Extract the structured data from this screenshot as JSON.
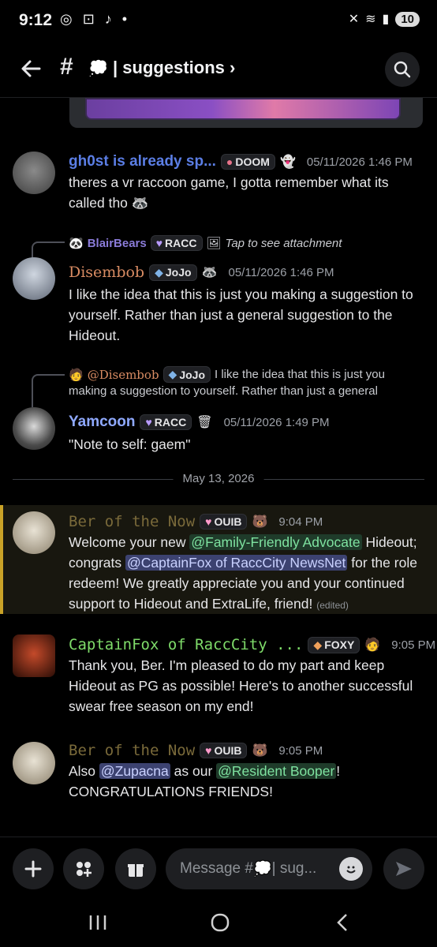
{
  "status": {
    "time": "9:12",
    "battery": "10"
  },
  "header": {
    "channel": "suggestions"
  },
  "messages": [
    {
      "author": "gh0st is already sp...",
      "tag": "DOOM",
      "time": "05/11/2026 1:46 PM",
      "text_a": "theres a vr raccoon game, I gotta remember what its",
      "text_b": "called tho"
    },
    {
      "reply_user": "BlairBears",
      "reply_tag": "RACC",
      "reply_text": "Tap to see attachment",
      "author": "Disembob",
      "tag": "JoJo",
      "time": "05/11/2026 1:46 PM",
      "text_a": "I like the idea that this is just you making a suggestion to",
      "text_b": "yourself. Rather than just a general suggestion to the",
      "text_c": "Hideout."
    },
    {
      "reply_user": "@Disembob",
      "reply_tag": "JoJo",
      "reply_text_a": "I like the idea that this is just you",
      "reply_text_b": "making a suggestion to yourself. Rather than just a general",
      "author": "Yamcoon",
      "tag": "RACC",
      "time": "05/11/2026 1:49 PM",
      "text_a": "\"Note to self: gaem\""
    },
    {
      "author": "Ber of the Now",
      "tag": "OUIB",
      "time": "9:04 PM",
      "p1": "Welcome your new ",
      "m1": "@Family-Friendly Advocate",
      "p2": " Hideout;",
      "p3": "congrats ",
      "m2": "@CaptainFox of RaccCity NewsNet",
      "p4": " for the role",
      "p5": "redeem! We greatly appreciate you and your continued",
      "p6": "support to Hideout and ExtraLife, friend!",
      "edited": "(edited)"
    },
    {
      "author": "CaptainFox of RaccCity ...",
      "tag": "FOXY",
      "time": "9:05 PM",
      "text_a": "Thank you, Ber. I'm pleased to do my part and keep",
      "text_b": "Hideout as PG as possible! Here's to another successful",
      "text_c": "swear free season on my end!"
    },
    {
      "author": "Ber of the Now",
      "tag": "OUIB",
      "time": "9:05 PM",
      "p1": "Also ",
      "m1": "@Zupacna",
      "p2": " as our ",
      "m2": "@Resident Booper",
      "p3": "!",
      "p4": "CONGRATULATIONS FRIENDS!"
    }
  ],
  "date_divider": "May 13, 2026",
  "composer": {
    "placeholder": "Message #",
    "placeholder_tail": "| sug..."
  },
  "colors": {
    "gh0st": "#5b7ee5",
    "disembob": "#d98c63",
    "yamcoon": "#8fa9ff",
    "ber": "#7a6a3a",
    "captain": "#7fdc6a"
  }
}
